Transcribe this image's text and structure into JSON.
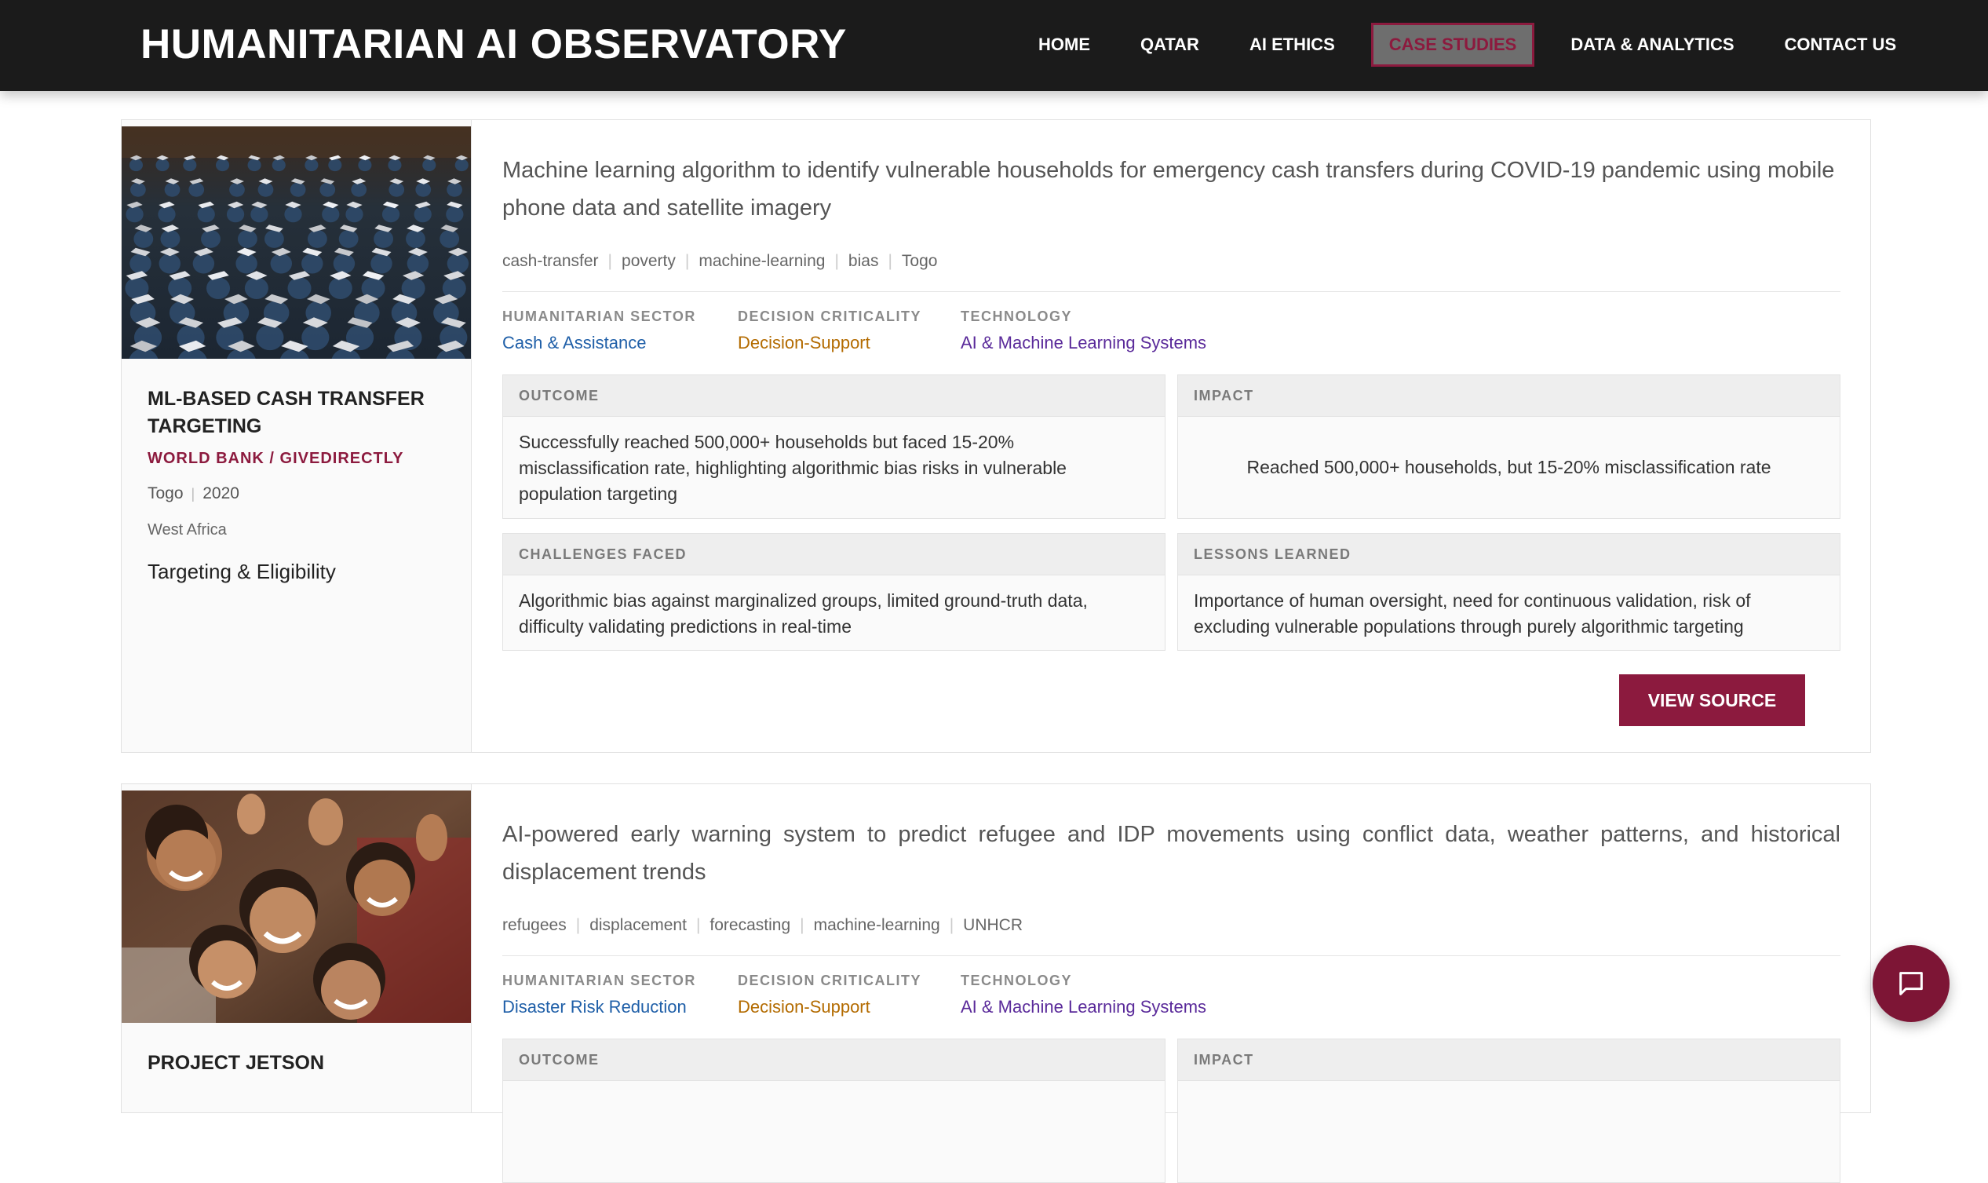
{
  "header": {
    "brand": "HUMANITARIAN AI OBSERVATORY",
    "nav": [
      {
        "label": "HOME",
        "active": false
      },
      {
        "label": "QATAR",
        "active": false
      },
      {
        "label": "AI ETHICS",
        "active": false
      },
      {
        "label": "CASE STUDIES",
        "active": true
      },
      {
        "label": "DATA & ANALYTICS",
        "active": false
      },
      {
        "label": "CONTACT US",
        "active": false
      }
    ]
  },
  "labels": {
    "sector": "HUMANITARIAN SECTOR",
    "criticality": "DECISION CRITICALITY",
    "technology": "TECHNOLOGY",
    "outcome": "OUTCOME",
    "impact": "IMPACT",
    "challenges": "CHALLENGES FACED",
    "lessons": "LESSONS LEARNED",
    "view_source": "VIEW SOURCE"
  },
  "cases": [
    {
      "title": "ML-BASED CASH TRANSFER TARGETING",
      "org": "WORLD BANK / GIVEDIRECTLY",
      "country": "Togo",
      "year": "2020",
      "region": "West Africa",
      "category": "Targeting & Eligibility",
      "description": "Machine learning algorithm to identify vulnerable households for emergency cash transfers during COVID-19 pandemic using mobile phone data and satellite imagery",
      "tags": [
        "cash-transfer",
        "poverty",
        "machine-learning",
        "bias",
        "Togo"
      ],
      "sector": "Cash & Assistance",
      "criticality": "Decision-Support",
      "technology": "AI & Machine Learning Systems",
      "outcome": "Successfully reached 500,000+ households but faced 15-20% misclassification rate, highlighting algorithmic bias risks in vulnerable population targeting",
      "impact": "Reached 500,000+ households, but 15-20% misclassification rate",
      "challenges": "Algorithmic bias against marginalized groups, limited ground-truth data, difficulty validating predictions in real-time",
      "lessons": "Importance of human oversight, need for continuous validation, risk of excluding vulnerable populations through purely algorithmic targeting",
      "image": "graduation-caps-photo"
    },
    {
      "title": "PROJECT JETSON",
      "description": "AI-powered early warning system to predict refugee and IDP movements using conflict data, weather patterns, and historical displacement trends",
      "tags": [
        "refugees",
        "displacement",
        "forecasting",
        "machine-learning",
        "UNHCR"
      ],
      "sector": "Disaster Risk Reduction",
      "criticality": "Decision-Support",
      "technology": "AI & Machine Learning Systems",
      "image": "smiling-children-photo"
    }
  ],
  "chat": {
    "icon": "chat-bubble-icon"
  },
  "colors": {
    "accent": "#8c1a3e",
    "nav_bg": "#1b1b1b",
    "sector": "#1f5fa8",
    "criticality": "#b36b00",
    "technology": "#5a2a9a"
  }
}
